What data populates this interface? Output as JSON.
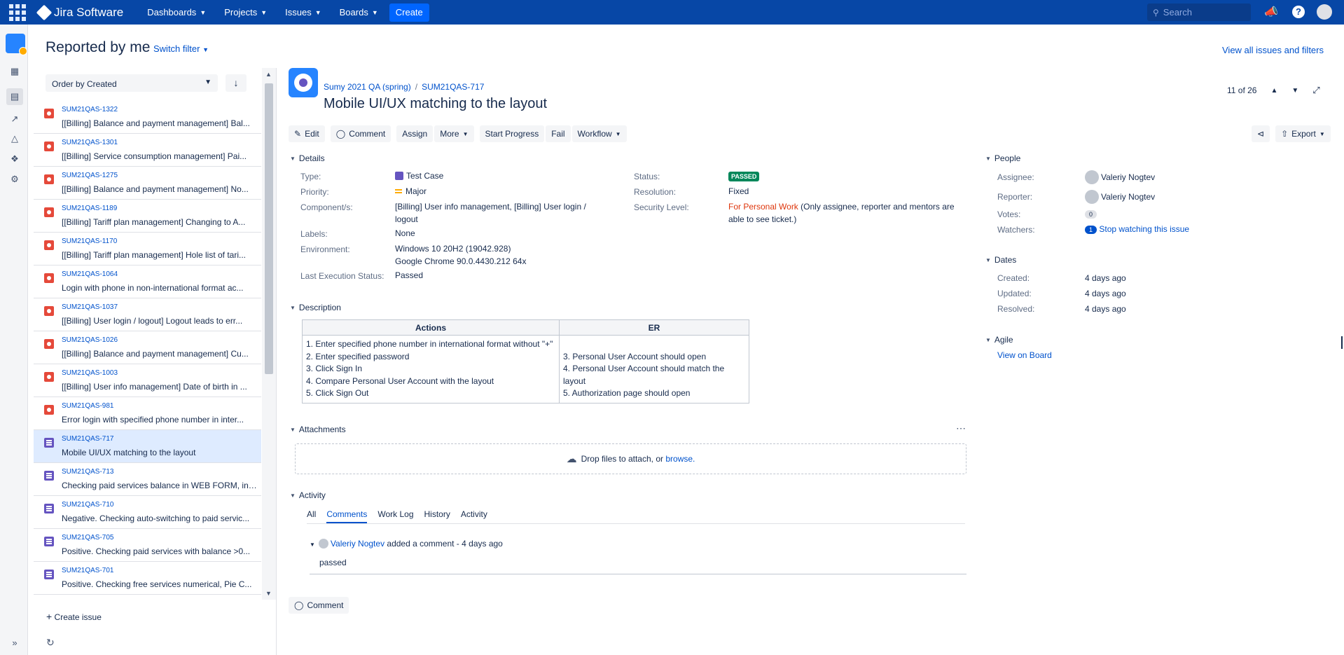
{
  "topnav": {
    "product": "Jira Software",
    "items": [
      {
        "label": "Dashboards"
      },
      {
        "label": "Projects"
      },
      {
        "label": "Issues"
      },
      {
        "label": "Boards"
      }
    ],
    "create_label": "Create",
    "search_placeholder": "Search"
  },
  "header": {
    "title": "Reported by me",
    "switch_filter": "Switch filter",
    "view_all": "View all issues and filters"
  },
  "list": {
    "order_by": "Order by Created",
    "issues": [
      {
        "key": "SUM21QAS-1322",
        "summary": "[[Billing] Balance and payment management] Bal...",
        "type": "bug"
      },
      {
        "key": "SUM21QAS-1301",
        "summary": "[[Billing] Service consumption management] Pai...",
        "type": "bug"
      },
      {
        "key": "SUM21QAS-1275",
        "summary": "[[Billing] Balance and payment management] No...",
        "type": "bug"
      },
      {
        "key": "SUM21QAS-1189",
        "summary": "[[Billing] Tariff plan management] Changing to A...",
        "type": "bug"
      },
      {
        "key": "SUM21QAS-1170",
        "summary": "[[Billing] Tariff plan management] Hole list of tari...",
        "type": "bug"
      },
      {
        "key": "SUM21QAS-1064",
        "summary": "Login with phone in non-international format ac...",
        "type": "bug"
      },
      {
        "key": "SUM21QAS-1037",
        "summary": "[[Billing] User login / logout] Logout leads to err...",
        "type": "bug"
      },
      {
        "key": "SUM21QAS-1026",
        "summary": "[[Billing] Balance and payment management] Cu...",
        "type": "bug"
      },
      {
        "key": "SUM21QAS-1003",
        "summary": "[[Billing] User info management] Date of birth in ...",
        "type": "bug"
      },
      {
        "key": "SUM21QAS-981",
        "summary": "Error login with specified phone number in inter...",
        "type": "bug"
      },
      {
        "key": "SUM21QAS-717",
        "summary": "Mobile UI/UX matching to the layout",
        "type": "test-case",
        "selected": true
      },
      {
        "key": "SUM21QAS-713",
        "summary": "Checking paid services balance in WEB FORM, in ...",
        "type": "test-case"
      },
      {
        "key": "SUM21QAS-710",
        "summary": "Negative. Checking auto-switching to paid servic...",
        "type": "test-case"
      },
      {
        "key": "SUM21QAS-705",
        "summary": "Positive. Checking paid services with balance >0...",
        "type": "test-case"
      },
      {
        "key": "SUM21QAS-701",
        "summary": "Positive. Checking free services numerical, Pie C...",
        "type": "test-case"
      }
    ],
    "create_issue": "Create issue"
  },
  "issue": {
    "project": "Sumy 2021 QA (spring)",
    "key": "SUM21QAS-717",
    "title": "Mobile UI/UX matching to the layout",
    "pager": "11 of 26",
    "toolbar": {
      "edit": "Edit",
      "comment": "Comment",
      "assign": "Assign",
      "more": "More",
      "start_progress": "Start Progress",
      "fail": "Fail",
      "workflow": "Workflow",
      "export": "Export"
    },
    "details": {
      "heading": "Details",
      "type_label": "Type:",
      "type": "Test Case",
      "priority_label": "Priority:",
      "priority": "Major",
      "components_label": "Component/s:",
      "components_line1": "[Billing] User info management, [Billing] User login /",
      "components_line2": "logout",
      "labels_label": "Labels:",
      "labels": "None",
      "environment_label": "Environment:",
      "environment_line1": "Windows 10 20H2 (19042.928)",
      "environment_line2": "Google Chrome 90.0.4430.212 64x",
      "last_exec_label": "Last Execution Status:",
      "last_exec": "Passed",
      "status_label": "Status:",
      "status": "PASSED",
      "resolution_label": "Resolution:",
      "resolution": "Fixed",
      "security_label": "Security Level:",
      "security_link": "For Personal Work",
      "security_note1": " (Only assignee, reporter and mentors are",
      "security_note2": "able to see ticket.)"
    },
    "description": {
      "heading": "Description",
      "col_actions": "Actions",
      "col_er": "ER",
      "actions": [
        "1. Enter specified phone number in international format without \"+\"",
        "2. Enter specified password",
        "3. Click Sign In",
        "4. Compare Personal User Account with the layout",
        "5. Click Sign Out"
      ],
      "er": [
        "3. Personal User Account should open",
        "4. Personal User Account should match the layout",
        "5. Authorization page should open"
      ]
    },
    "attachments": {
      "heading": "Attachments",
      "drop_text": "Drop files to attach, or ",
      "browse": "browse."
    },
    "activity": {
      "heading": "Activity",
      "tabs": [
        "All",
        "Comments",
        "Work Log",
        "History",
        "Activity"
      ],
      "comment_author": "Valeriy Nogtev",
      "comment_meta": " added a comment - 4 days ago",
      "comment_body": "passed",
      "comment_button": "Comment"
    },
    "people": {
      "heading": "People",
      "assignee_label": "Assignee:",
      "assignee": "Valeriy Nogtev",
      "reporter_label": "Reporter:",
      "reporter": "Valeriy Nogtev",
      "votes_label": "Votes:",
      "votes": "0",
      "watchers_label": "Watchers:",
      "watchers": "1",
      "stop_watching": "Stop watching this issue"
    },
    "dates": {
      "heading": "Dates",
      "created_label": "Created:",
      "created": "4 days ago",
      "updated_label": "Updated:",
      "updated": "4 days ago",
      "resolved_label": "Resolved:",
      "resolved": "4 days ago"
    },
    "agile": {
      "heading": "Agile",
      "view_on_board": "View on Board"
    }
  }
}
